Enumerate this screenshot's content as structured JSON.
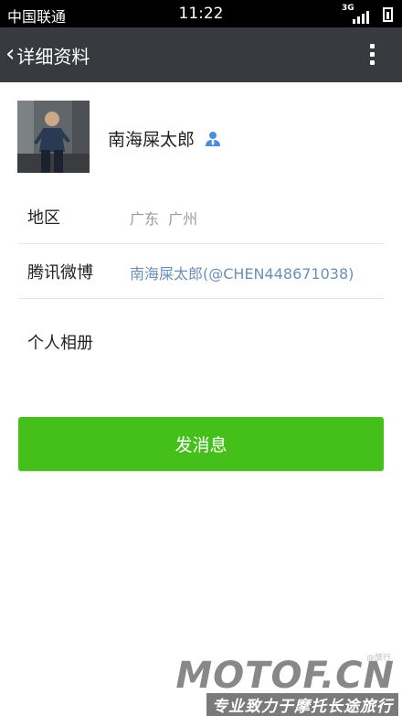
{
  "status_bar": {
    "carrier": "中国联通",
    "time": "11:22",
    "network": "3G"
  },
  "header": {
    "title": "详细资料"
  },
  "profile": {
    "nickname": "南海屎太郎"
  },
  "info": {
    "region_label": "地区",
    "region_value": "广东  广州",
    "weibo_label": "腾讯微博",
    "weibo_value": "南海屎太郎(@CHEN448671038)",
    "album_label": "个人相册"
  },
  "actions": {
    "send_message": "发消息"
  },
  "watermark": {
    "logo": "MOTOF.CN",
    "slogan": "专业致力于摩托长途旅行",
    "small_text": "@旅行"
  },
  "colors": {
    "app_bar": "#393a3f",
    "primary_button": "#45c01a",
    "link_text": "#6c8fb6"
  }
}
